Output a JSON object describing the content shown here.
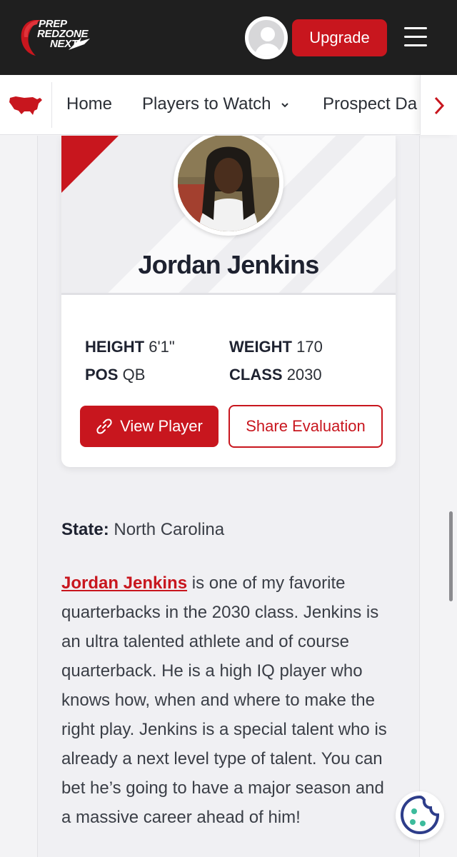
{
  "header": {
    "logo_lines": [
      "PREP",
      "REDZONE",
      "NEXT"
    ],
    "upgrade_label": "Upgrade",
    "brand_color": "#c8161e"
  },
  "nav": {
    "items": [
      "Home",
      "Players to Watch",
      "Prospect Da"
    ],
    "icons": [
      "us-map-icon",
      "chevron-down-icon",
      "chevron-right-icon"
    ]
  },
  "player": {
    "name": "Jordan Jenkins",
    "height_label": "HEIGHT",
    "height": "6'1\"",
    "weight_label": "WEIGHT",
    "weight": "170",
    "pos_label": "POS",
    "pos": "QB",
    "class_label": "CLASS",
    "class": "2030",
    "view_label": "View Player",
    "share_label": "Share Evaluation"
  },
  "article": {
    "state_label": "State:",
    "state": "North Carolina",
    "link_text": "Jordan Jenkins",
    "paragraph": " is one of my favorite quarterbacks in the 2030 class. Jenkins is an ultra talented athlete and of course quarterback. He is a high IQ player who knows how, when and where to make the right play. Jenkins is a special talent who is already a next level type of talent. You can bet he’s going to have a major season and a massive career ahead of him!"
  }
}
